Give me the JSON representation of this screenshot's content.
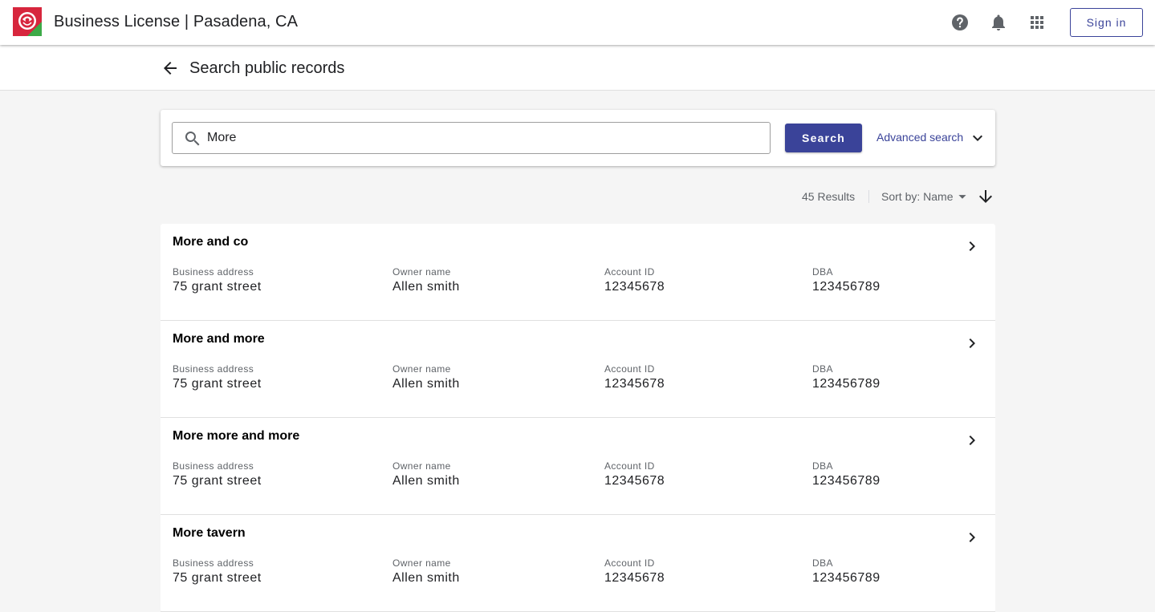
{
  "header": {
    "title": "Business License | Pasadena, CA",
    "logo": "pasadena-rose-logo",
    "icons": [
      "help-icon",
      "notifications-icon",
      "apps-grid-icon"
    ],
    "sign_in_label": "Sign in"
  },
  "subheader": {
    "title": "Search public records"
  },
  "search": {
    "value": "More",
    "button_label": "Search",
    "advanced_label": "Advanced search"
  },
  "results_bar": {
    "count_label": "45 Results",
    "sort_label": "Sort by: Name"
  },
  "field_labels": {
    "address": "Business address",
    "owner": "Owner name",
    "account": "Account ID",
    "dba": "DBA"
  },
  "results": [
    {
      "name": "More and co",
      "address": "75 grant street",
      "owner": "Allen smith",
      "account": "12345678",
      "dba": "123456789"
    },
    {
      "name": "More and more",
      "address": "75 grant street",
      "owner": "Allen smith",
      "account": "12345678",
      "dba": "123456789"
    },
    {
      "name": "More more and more",
      "address": "75 grant street",
      "owner": "Allen smith",
      "account": "12345678",
      "dba": "123456789"
    },
    {
      "name": "More tavern",
      "address": "75 grant street",
      "owner": "Allen smith",
      "account": "12345678",
      "dba": "123456789"
    }
  ],
  "colors": {
    "accent": "#3a4399",
    "background": "#f5f5f5",
    "logo_red": "#d7263d",
    "logo_green": "#3daa48"
  }
}
